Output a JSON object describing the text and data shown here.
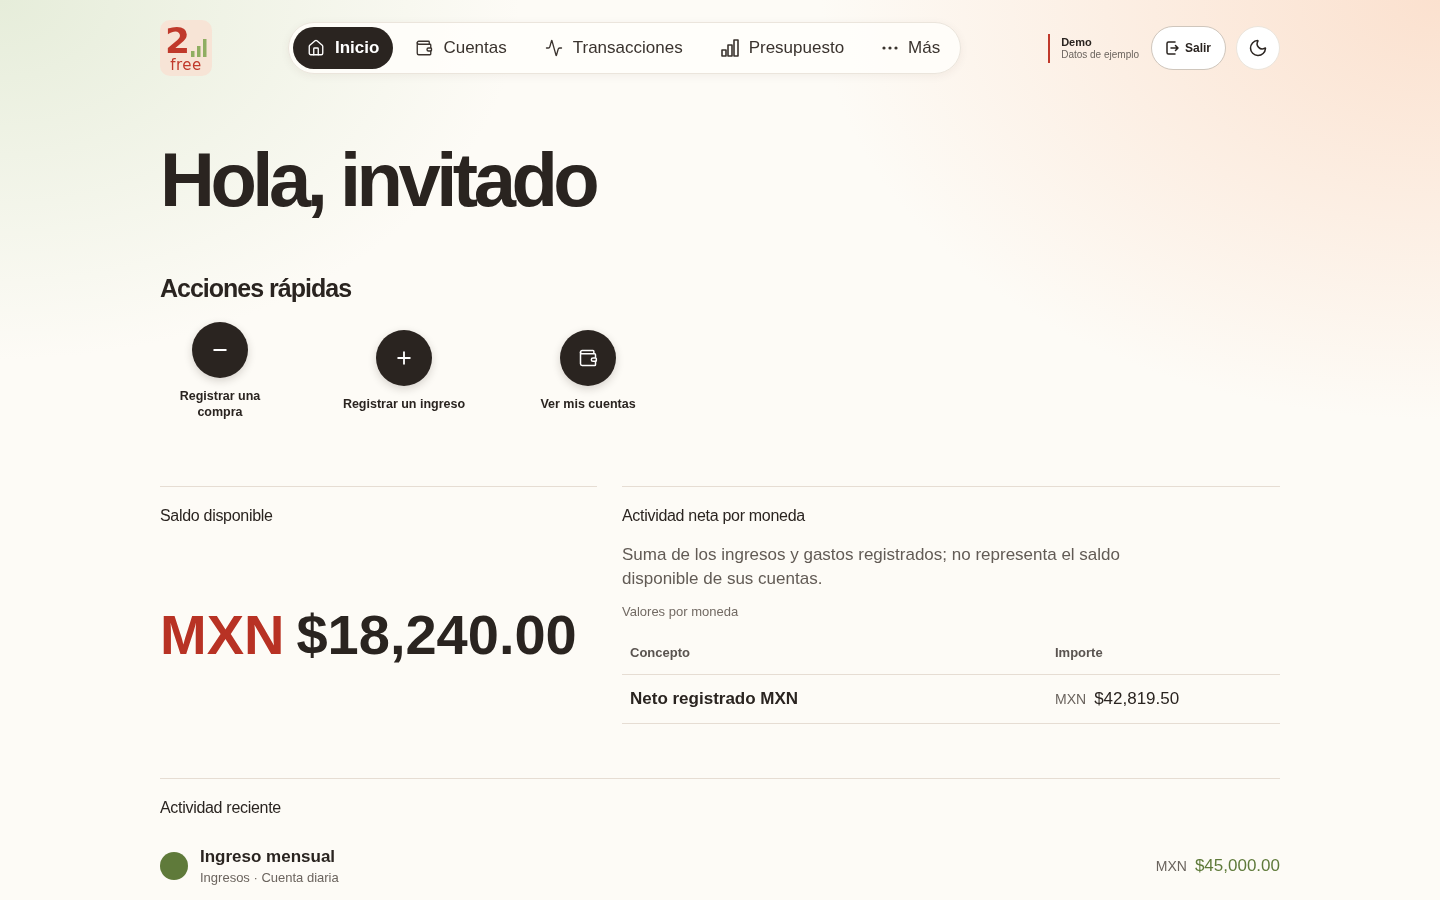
{
  "header": {
    "logo": {
      "mark": "2",
      "text": "free"
    },
    "nav": [
      {
        "label": "Inicio",
        "kind": "home",
        "selected": true
      },
      {
        "label": "Cuentas",
        "kind": "wallet",
        "selected": false
      },
      {
        "label": "Transacciones",
        "kind": "activity",
        "selected": false
      },
      {
        "label": "Presupuesto",
        "kind": "budget",
        "selected": false
      },
      {
        "label": "Más",
        "kind": "more",
        "selected": false
      }
    ],
    "mode": {
      "title": "Demo",
      "subtitle": "Datos de ejemplo"
    },
    "logout_button": {
      "label": "Salir"
    }
  },
  "greeting": "Hola, invitado",
  "quick_actions": {
    "title": "Acciones rápidas",
    "items": [
      {
        "label": "Registrar una compra",
        "kind": "minus"
      },
      {
        "label": "Registrar un ingreso",
        "kind": "plus"
      },
      {
        "label": "Ver mis cuentas",
        "kind": "wallet"
      }
    ]
  },
  "balance": {
    "title": "Saldo disponible",
    "currency": "MXN",
    "amount": "$18,240.00"
  },
  "net_activity": {
    "title": "Actividad neta por moneda",
    "description": "Suma de los ingresos y gastos registrados; no representa el saldo disponible de sus cuentas.",
    "caption": "Valores por moneda",
    "columns": [
      "Concepto",
      "Importe"
    ],
    "rows": [
      {
        "concept": "Neto registrado MXN",
        "currency": "MXN",
        "amount": "$42,819.50"
      }
    ]
  },
  "recent_activity": {
    "title": "Actividad reciente",
    "items": [
      {
        "title": "Ingreso mensual",
        "meta": "Ingresos · Cuenta diaria",
        "currency": "MXN",
        "amount": "$45,000.00",
        "color": "#5f7a3a"
      }
    ]
  }
}
